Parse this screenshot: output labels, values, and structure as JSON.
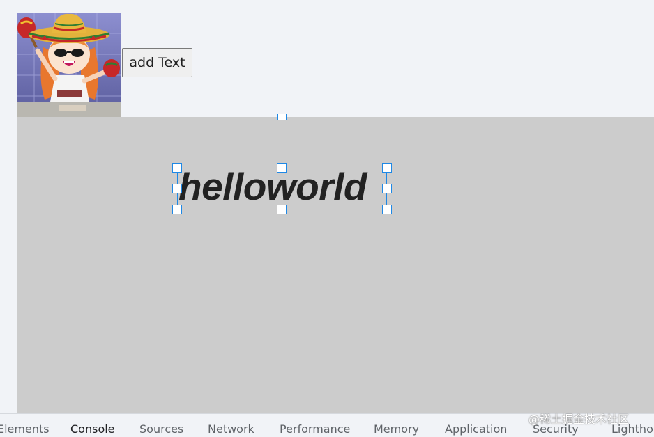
{
  "toolbar": {
    "add_text_label": "add Text"
  },
  "canvas": {
    "text_object": "helloworld",
    "background_color": "#cccccc",
    "selection_color": "#1e88e5"
  },
  "devtools": {
    "tabs": [
      {
        "label": "Elements"
      },
      {
        "label": "Console"
      },
      {
        "label": "Sources"
      },
      {
        "label": "Network"
      },
      {
        "label": "Performance"
      },
      {
        "label": "Memory"
      },
      {
        "label": "Application"
      },
      {
        "label": "Security"
      },
      {
        "label": "Lighthouse"
      }
    ]
  },
  "watermark": "@稀土掘金技术社区"
}
